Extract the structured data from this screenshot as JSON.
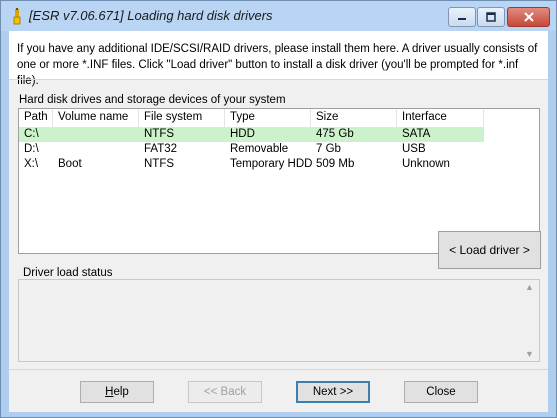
{
  "window": {
    "title": "[ESR v7.06.671]  Loading hard disk drivers"
  },
  "header": {
    "text": "If you have any additional IDE/SCSI/RAID drivers, please install them here. A driver usually consists of one or more *.INF files. Click \"Load driver\" button to install a disk driver (you'll be prompted for *.inf file)."
  },
  "devices": {
    "label": "Hard disk drives and storage devices of your system",
    "columns": [
      "Path",
      "Volume name",
      "File system",
      "Type",
      "Size",
      "Interface"
    ],
    "rows": [
      [
        "C:\\",
        "",
        "NTFS",
        "HDD",
        "475 Gb",
        "SATA"
      ],
      [
        "D:\\",
        "",
        "FAT32",
        "Removable",
        "7 Gb",
        "USB"
      ],
      [
        "X:\\",
        "Boot",
        "NTFS",
        "Temporary HDD",
        "509 Mb",
        "Unknown"
      ]
    ],
    "selected_row": 0
  },
  "load_driver": {
    "label": "< Load driver >"
  },
  "status": {
    "label": "Driver load status"
  },
  "buttons": {
    "help": "Help",
    "back": "<< Back",
    "next": "Next >>",
    "close": "Close"
  },
  "colors": {
    "selected_row": "#ccf2cc",
    "title_bar": "#b9d5f3",
    "close_button": "#c7493a"
  }
}
